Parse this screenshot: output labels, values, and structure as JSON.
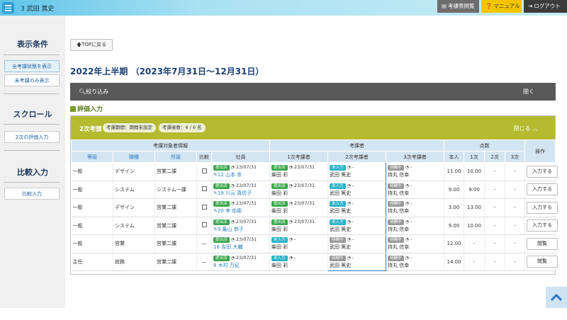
{
  "header": {
    "user_name": "3 武田 篤史",
    "eval_button": "考課表閲覧",
    "manual_button": "マニュアル",
    "logout_button": "ログアウト"
  },
  "sidebar": {
    "display_title": "表示条件",
    "all_status": "全考課状態を表示",
    "unevaluated_only": "未考課のみ表示",
    "scroll_title": "スクロール",
    "second_eval_input": "2次の評価入力",
    "compare_title": "比較入力",
    "compare_input": "比較入力"
  },
  "main": {
    "top_button": "TOPに戻る",
    "page_title": "2022年上半期 （2023年7月31日～12月31日）",
    "filter_label": "絞り込み",
    "filter_close": "閉く",
    "section_title": "評価入力"
  },
  "panel": {
    "title": "2次考課",
    "period_pill": "考課期間：期間未設定",
    "count_pill": "考課者数：6 / 6 名",
    "close_label": "閉じる ︿"
  },
  "table": {
    "group_headers": {
      "target_info": "考課対象者情報",
      "evaluators": "考課者",
      "points": "点数",
      "actions": "操作"
    },
    "columns": {
      "grade": "等級",
      "job": "職種",
      "dept": "所属",
      "compare": "比較",
      "employee": "社員",
      "first": "1次考課者",
      "second": "2次考課者",
      "third": "3次考課者",
      "self": "本人",
      "p1": "1次",
      "p2": "2次",
      "p3": "3次"
    },
    "rows": [
      {
        "grade": "一般",
        "job": "デザイン",
        "dept": "営業二課",
        "compare": "",
        "emp_tag": "提出済",
        "emp_date": "23/07/31",
        "emp_name": "12 山本 崇",
        "first_tag": "提出済",
        "first_date": "23/07/31",
        "first_name": "柴田 彩",
        "second_tag": "未入力",
        "second_date": "-",
        "second_name": "武田 篤史",
        "third_tag": "待機中",
        "third_date": "-",
        "third_name": "持丸 信幸",
        "self": "11.00",
        "p1": "10.00",
        "p2": "-",
        "p3": "-",
        "action": "入力する"
      },
      {
        "grade": "一般",
        "job": "システム",
        "dept": "システム一課",
        "compare": "",
        "emp_tag": "提出済",
        "emp_date": "23/07/31",
        "emp_name": "19 川元 真佐子",
        "first_tag": "提出済",
        "first_date": "23/07/31",
        "first_name": "柴田 彩",
        "second_tag": "未入力",
        "second_date": "-",
        "second_name": "武田 篤史",
        "third_tag": "待機中",
        "third_date": "-",
        "third_name": "持丸 信幸",
        "self": "9.00",
        "p1": "9.00",
        "p2": "-",
        "p3": "-",
        "action": "入力する"
      },
      {
        "grade": "一般",
        "job": "デザイン",
        "dept": "営業二課",
        "compare": "",
        "emp_tag": "提出済",
        "emp_date": "23/07/31",
        "emp_name": "20 李 佑衛",
        "first_tag": "提出済",
        "first_date": "23/07/31",
        "first_name": "柴田 彩",
        "second_tag": "未入力",
        "second_date": "-",
        "second_name": "武田 篤史",
        "third_tag": "待機中",
        "third_date": "-",
        "third_name": "持丸 信幸",
        "self": "3.00",
        "p1": "13.00",
        "p2": "-",
        "p3": "-",
        "action": "入力する"
      },
      {
        "grade": "一般",
        "job": "システム",
        "dept": "営業二課",
        "compare": "",
        "emp_tag": "提出済",
        "emp_date": "23/07/31",
        "emp_name": "9 亀山 恭子",
        "first_tag": "提出済",
        "first_date": "23/07/31",
        "first_name": "柴田 彩",
        "second_tag": "未入力",
        "second_date": "-",
        "second_name": "武田 篤史",
        "third_tag": "待機中",
        "third_date": "-",
        "third_name": "持丸 信幸",
        "self": "9.00",
        "p1": "10.00",
        "p2": "-",
        "p3": "-",
        "action": "入力する"
      },
      {
        "grade": "一般",
        "job": "営業",
        "dept": "営業二課",
        "compare": "—",
        "emp_tag": "提出済",
        "emp_date": "23/07/31",
        "emp_name": "16 吉田 大輔",
        "first_tag": "未入力",
        "first_date": "-",
        "first_name": "柴田 彩",
        "second_tag": "待機中",
        "second_date": "-",
        "second_name": "武田 篤史",
        "third_tag": "待機中",
        "third_date": "-",
        "third_name": "持丸 信幸",
        "self": "12.00",
        "p1": "-",
        "p2": "-",
        "p3": "-",
        "action": "閲覧"
      },
      {
        "grade": "主任",
        "job": "総務",
        "dept": "営業二課",
        "compare": "—",
        "emp_tag": "提出済",
        "emp_date": "23/07/31",
        "emp_name": "8 木村 万紀",
        "first_tag": "未入力",
        "first_date": "-",
        "first_name": "柴田 彩",
        "second_tag": "待機中",
        "second_date": "-",
        "second_name": "武田 篤史",
        "third_tag": "待機中",
        "third_date": "-",
        "third_name": "持丸 信幸",
        "self": "14.00",
        "p1": "-",
        "p2": "-",
        "p3": "-",
        "action": "閲覧"
      }
    ]
  }
}
